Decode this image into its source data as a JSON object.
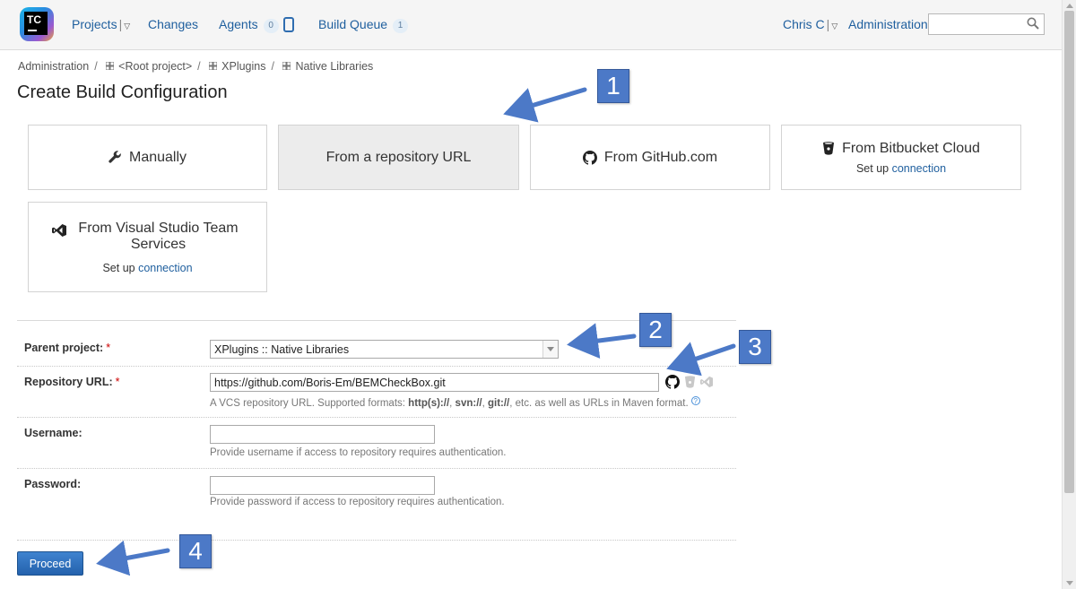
{
  "logo": {
    "text": "TC"
  },
  "nav": {
    "projects": "Projects",
    "changes": "Changes",
    "agents": "Agents",
    "agents_count": "0",
    "build_queue": "Build Queue",
    "build_queue_count": "1",
    "user": "Chris C",
    "administration": "Administration",
    "search_value": ""
  },
  "breadcrumb": {
    "items": [
      "Administration",
      "<Root project>",
      "XPlugins",
      "Native Libraries"
    ],
    "separator": "/"
  },
  "page": {
    "title": "Create Build Configuration"
  },
  "tiles": {
    "manually": "Manually",
    "repo_url": "From a repository URL",
    "github": "From GitHub.com",
    "bitbucket": "From Bitbucket Cloud",
    "vsts": "From Visual Studio Team Services",
    "setup_prefix": "Set up",
    "setup_link": "connection"
  },
  "form": {
    "parent_label": "Parent project:",
    "parent_value": "XPlugins :: Native Libraries",
    "repo_label": "Repository URL:",
    "repo_value": "https://github.com/Boris-Em/BEMCheckBox.git",
    "repo_note_prefix": "A VCS repository URL. Supported formats:",
    "repo_note_f1": "http(s)://",
    "repo_note_f2": "svn://",
    "repo_note_f3": "git://",
    "repo_note_suffix": "etc. as well as URLs in Maven format.",
    "username_label": "Username:",
    "username_value": "",
    "username_note": "Provide username if access to repository requires authentication.",
    "password_label": "Password:",
    "password_value": "",
    "password_note": "Provide password if access to repository requires authentication.",
    "required_mark": "*",
    "help_glyph": "?"
  },
  "proceed_label": "Proceed",
  "callouts": [
    "1",
    "2",
    "3",
    "4"
  ],
  "colors": {
    "link": "#1f5f9e",
    "callout": "#4c79c7",
    "button": "#2f6db6",
    "selected_tile": "#ececec"
  },
  "icons": [
    "search-icon",
    "wrench-icon",
    "github-icon",
    "bitbucket-icon",
    "visual-studio-icon",
    "grid-icon",
    "chevron-down-icon",
    "help-icon"
  ]
}
